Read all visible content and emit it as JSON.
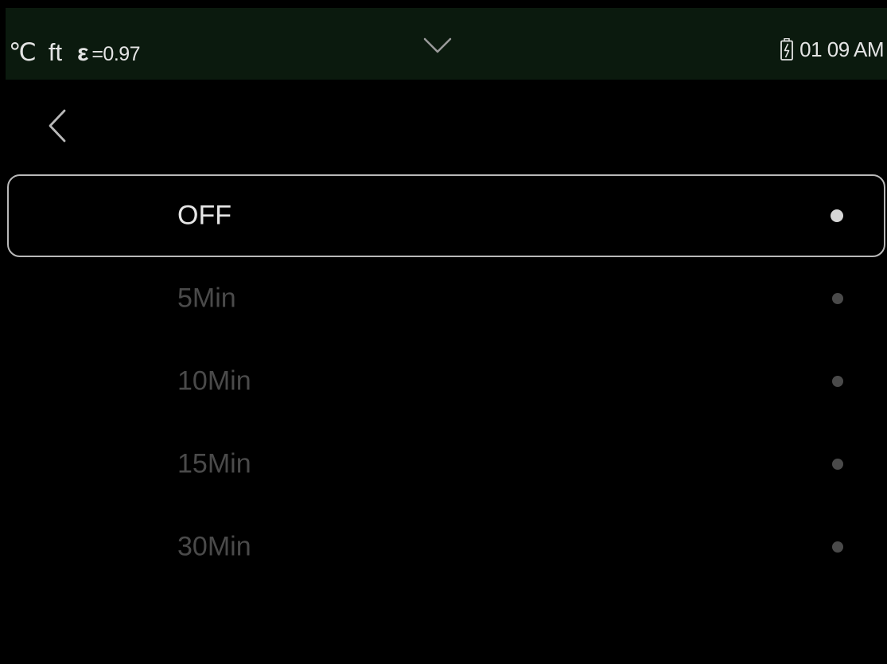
{
  "status_bar": {
    "temperature_unit": "℃",
    "distance_unit": "ft",
    "emissivity_symbol": "ε",
    "emissivity_value": "=0.97",
    "dropdown_icon": "chevron-down-icon",
    "battery_icon": "battery-charging-icon",
    "time": "01 09 AM"
  },
  "navigation": {
    "back_icon": "chevron-left-icon"
  },
  "options": [
    {
      "label": "OFF",
      "selected": true
    },
    {
      "label": "5Min",
      "selected": false
    },
    {
      "label": "10Min",
      "selected": false
    },
    {
      "label": "15Min",
      "selected": false
    },
    {
      "label": "30Min",
      "selected": false
    }
  ],
  "colors": {
    "status_bar_bg": "#0b1a0e",
    "background": "#000000",
    "selected_text": "#e6e6e6",
    "unselected_text": "#4a4a4a",
    "selected_border": "#b9b9b9"
  }
}
